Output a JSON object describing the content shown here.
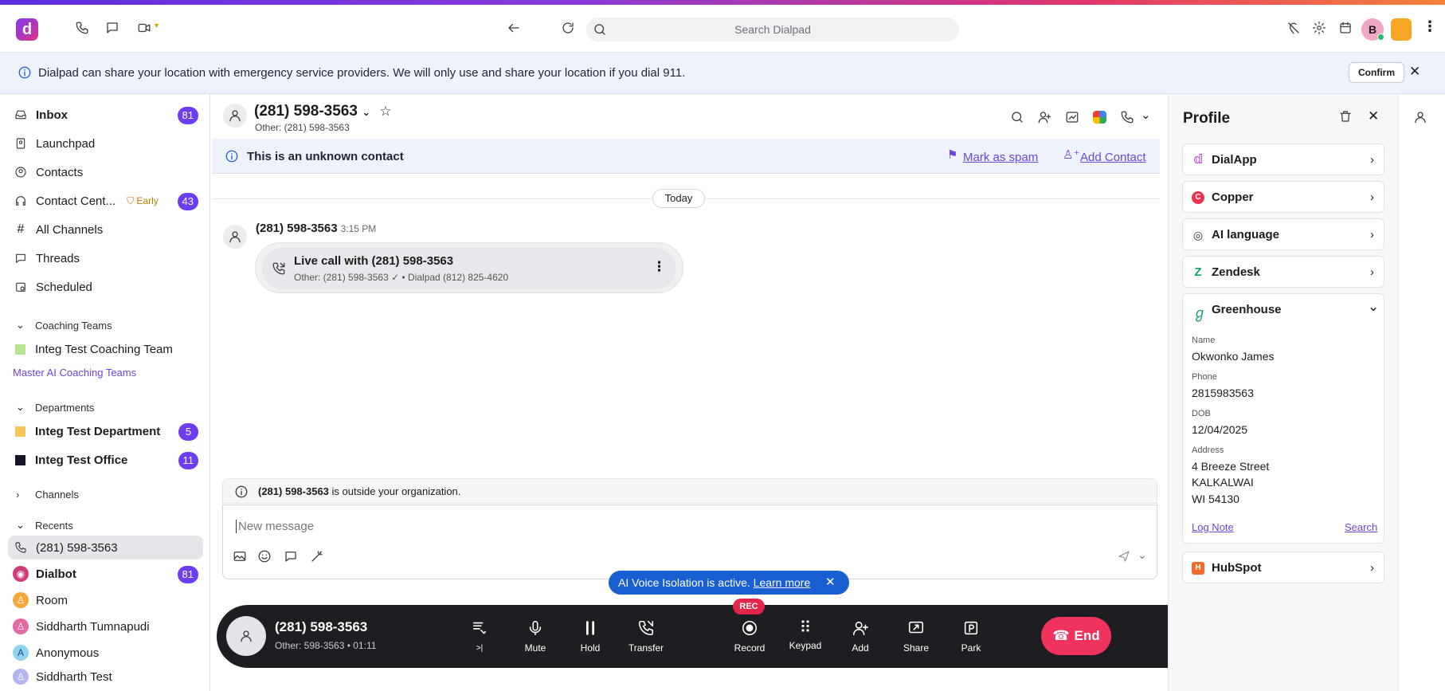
{
  "app": {
    "logo_letter": "d"
  },
  "topbar": {
    "search_placeholder": "Search Dialpad",
    "user_initial": "B"
  },
  "banner": {
    "text": "Dialpad can share your location with emergency service providers. We will only use and share your location if you dial 911.",
    "confirm_label": "Confirm"
  },
  "sidebar": {
    "items": [
      {
        "label": "Inbox",
        "badge": "81"
      },
      {
        "label": "Launchpad"
      },
      {
        "label": "Contacts"
      },
      {
        "label": "Contact Cent...",
        "tag": "Early",
        "badge": "43"
      },
      {
        "label": "All Channels"
      },
      {
        "label": "Threads"
      },
      {
        "label": "Scheduled"
      }
    ],
    "coaching_header": "Coaching Teams",
    "coaching_team": "Integ Test Coaching Team",
    "master_link": "Master AI Coaching Teams",
    "departments_header": "Departments",
    "departments": [
      {
        "label": "Integ Test Department",
        "badge": "5"
      },
      {
        "label": "Integ Test Office",
        "badge": "11"
      }
    ],
    "channels_header": "Channels",
    "recents_header": "Recents",
    "recents": [
      {
        "label": "(281) 598-3563"
      },
      {
        "label": "Dialbot",
        "badge": "81"
      },
      {
        "label": "Room"
      },
      {
        "label": "Siddharth Tumnapudi"
      },
      {
        "label": "Anonymous",
        "initial": "A"
      },
      {
        "label": "Siddharth Test"
      }
    ]
  },
  "chat": {
    "title": "(281) 598-3563",
    "subtitle": "Other: (281) 598-3563",
    "unknown_text": "This is an unknown contact",
    "mark_spam": "Mark as spam",
    "add_contact": "Add Contact",
    "day_divider": "Today",
    "message_sender": "(281) 598-3563",
    "message_time": "3:15 PM",
    "call_title": "Live call with (281) 598-3563",
    "call_sub_other": "Other: (281) 598-3563",
    "call_sub_dialpad": "• Dialpad (812) 825-4620",
    "outside_number": "(281) 598-3563",
    "outside_text": " is outside your organization.",
    "composer_placeholder": "New message"
  },
  "voice_banner": {
    "text": "AI Voice Isolation is active.",
    "link": "Learn more"
  },
  "callbar": {
    "name": "(281) 598-3563",
    "sub": "Other: 598-3563  •  01:11",
    "rec": "REC",
    "controls": [
      "Mute",
      "Hold",
      "Transfer",
      "Record",
      "Keypad",
      "Add",
      "Share",
      "Park"
    ],
    "end_label": "End"
  },
  "profile": {
    "title": "Profile",
    "cards": [
      {
        "label": "DialApp"
      },
      {
        "label": "Copper"
      },
      {
        "label": "AI language"
      },
      {
        "label": "Zendesk"
      }
    ],
    "greenhouse": {
      "label": "Greenhouse",
      "name_label": "Name",
      "name": "Okwonko James",
      "phone_label": "Phone",
      "phone": "2815983563",
      "dob_label": "DOB",
      "dob": "12/04/2025",
      "address_label": "Address",
      "address1": "4 Breeze Street",
      "address2": "KALKALWAI",
      "address3": "WI 54130",
      "log_note": "Log Note",
      "search": "Search"
    },
    "hubspot": "HubSpot"
  },
  "colors": {
    "accent": "#6d3df0",
    "end": "#f0335c",
    "voice": "#1a5fd1"
  }
}
